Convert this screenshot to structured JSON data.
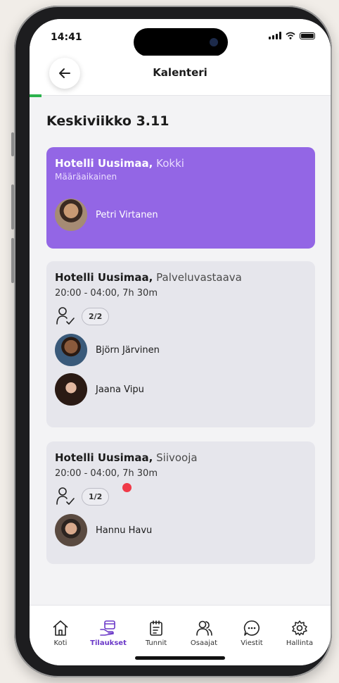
{
  "status_bar": {
    "time": "14:41"
  },
  "header": {
    "title": "Kalenteri"
  },
  "day_title": "Keskiviikko 3.11",
  "shifts": [
    {
      "employer": "Hotelli Uusimaa,",
      "role": "Kokki",
      "subtitle": "Määräaikainen",
      "people": [
        {
          "name": "Petri Virtanen"
        }
      ]
    },
    {
      "employer": "Hotelli Uusimaa,",
      "role": "Palveluvastaava",
      "time": "20:00 - 04:00, 7h 30m",
      "filled": "2/2",
      "people": [
        {
          "name": "Björn Järvinen"
        },
        {
          "name": "Jaana Vipu"
        }
      ]
    },
    {
      "employer": "Hotelli Uusimaa,",
      "role": "Siivooja",
      "time": "20:00 - 04:00, 7h 30m",
      "filled": "1/2",
      "people": [
        {
          "name": "Hannu Havu"
        }
      ]
    }
  ],
  "progress": 0.04,
  "tabs": [
    {
      "label": "Koti",
      "icon": "home-icon"
    },
    {
      "label": "Tilaukset",
      "icon": "orders-icon",
      "active": true
    },
    {
      "label": "Tunnit",
      "icon": "clipboard-icon"
    },
    {
      "label": "Osaajat",
      "icon": "people-icon"
    },
    {
      "label": "Viestit",
      "icon": "chat-icon"
    },
    {
      "label": "Hallinta",
      "icon": "gear-icon"
    }
  ],
  "colors": {
    "accent": "#9366e5",
    "active_tab": "#6b39c8",
    "progress": "#2bb24c",
    "alert": "#f03a48"
  }
}
